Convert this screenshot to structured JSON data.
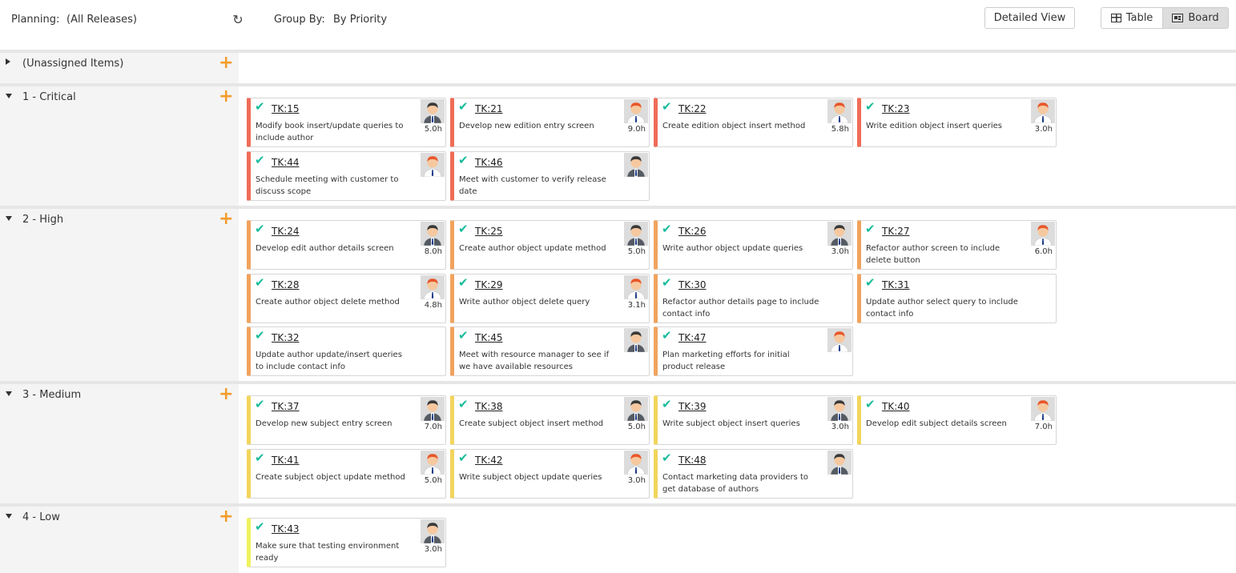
{
  "toolbar": {
    "planning_label": "Planning:",
    "planning_value": "(All Releases)",
    "refresh_icon": "refresh-icon",
    "group_label": "Group By:",
    "group_value": "By Priority",
    "detailed_view": "Detailed View",
    "table_label": "Table",
    "board_label": "Board"
  },
  "colors": {
    "critical": "#ef6c57",
    "high": "#f0a35e",
    "medium": "#f2d55c",
    "low": "#eef25c",
    "check": "#1abc9c",
    "plus": "#f39c2a"
  },
  "lanes": [
    {
      "title": "(Unassigned Items)",
      "expanded": false,
      "cards": []
    },
    {
      "title": "1 - Critical",
      "expanded": true,
      "color": "#ef6c57",
      "cards": [
        {
          "id": "TK:15",
          "desc": "Modify book insert/update queries to include author",
          "hours": "5.0h",
          "avatar": "dark"
        },
        {
          "id": "TK:21",
          "desc": "Develop new edition entry screen",
          "hours": "9.0h",
          "avatar": "red"
        },
        {
          "id": "TK:22",
          "desc": "Create edition object insert method",
          "hours": "5.8h",
          "avatar": "red"
        },
        {
          "id": "TK:23",
          "desc": "Write edition object insert queries",
          "hours": "3.0h",
          "avatar": "red"
        },
        {
          "id": "TK:44",
          "desc": "Schedule meeting with customer to discuss scope",
          "hours": "",
          "avatar": "red"
        },
        {
          "id": "TK:46",
          "desc": "Meet with customer to verify release date",
          "hours": "",
          "avatar": "dark"
        }
      ]
    },
    {
      "title": "2 - High",
      "expanded": true,
      "color": "#f0a35e",
      "cards": [
        {
          "id": "TK:24",
          "desc": "Develop edit author details screen",
          "hours": "8.0h",
          "avatar": "dark"
        },
        {
          "id": "TK:25",
          "desc": "Create author object update method",
          "hours": "5.0h",
          "avatar": "dark"
        },
        {
          "id": "TK:26",
          "desc": "Write author object update queries",
          "hours": "3.0h",
          "avatar": "dark"
        },
        {
          "id": "TK:27",
          "desc": "Refactor author screen to include delete button",
          "hours": "6.0h",
          "avatar": "red"
        },
        {
          "id": "TK:28",
          "desc": "Create author object delete method",
          "hours": "4.8h",
          "avatar": "red"
        },
        {
          "id": "TK:29",
          "desc": "Write author object delete query",
          "hours": "3.1h",
          "avatar": "red"
        },
        {
          "id": "TK:30",
          "desc": "Refactor author details page to include contact info",
          "hours": "",
          "avatar": ""
        },
        {
          "id": "TK:31",
          "desc": "Update author select query to include contact info",
          "hours": "",
          "avatar": ""
        },
        {
          "id": "TK:32",
          "desc": "Update author update/insert queries to include contact info",
          "hours": "",
          "avatar": ""
        },
        {
          "id": "TK:45",
          "desc": "Meet with resource manager to see if we have available resources",
          "hours": "",
          "avatar": "dark"
        },
        {
          "id": "TK:47",
          "desc": "Plan marketing efforts for initial product release",
          "hours": "",
          "avatar": "red"
        }
      ]
    },
    {
      "title": "3 - Medium",
      "expanded": true,
      "color": "#f2d55c",
      "cards": [
        {
          "id": "TK:37",
          "desc": "Develop new subject entry screen",
          "hours": "7.0h",
          "avatar": "dark"
        },
        {
          "id": "TK:38",
          "desc": "Create subject object insert method",
          "hours": "5.0h",
          "avatar": "dark"
        },
        {
          "id": "TK:39",
          "desc": "Write subject object insert queries",
          "hours": "3.0h",
          "avatar": "dark"
        },
        {
          "id": "TK:40",
          "desc": "Develop edit subject details screen",
          "hours": "7.0h",
          "avatar": "red"
        },
        {
          "id": "TK:41",
          "desc": "Create subject object update method",
          "hours": "5.0h",
          "avatar": "red"
        },
        {
          "id": "TK:42",
          "desc": "Write subject object update queries",
          "hours": "3.0h",
          "avatar": "red"
        },
        {
          "id": "TK:48",
          "desc": "Contact marketing data providers to get database of authors",
          "hours": "",
          "avatar": "dark"
        }
      ]
    },
    {
      "title": "4 - Low",
      "expanded": true,
      "color": "#eef25c",
      "cards": [
        {
          "id": "TK:43",
          "desc": "Make sure that testing environment ready",
          "hours": "3.0h",
          "avatar": "dark"
        }
      ]
    }
  ]
}
